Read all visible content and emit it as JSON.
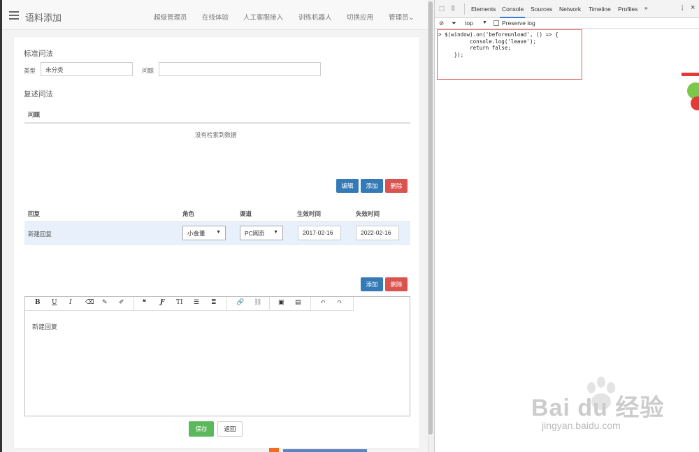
{
  "app": {
    "title": "语料添加",
    "nav": [
      "超级管理员",
      "在线体验",
      "人工客服接入",
      "训练机器人",
      "切换应用",
      "管理员"
    ]
  },
  "standard": {
    "heading": "标准问法",
    "type_label": "类型",
    "type_value": "未分类",
    "question_label": "问题",
    "question_value": ""
  },
  "paraphrase": {
    "heading": "复述问法",
    "col": "问题",
    "empty": "没有检索到数据",
    "btn_edit": "编辑",
    "btn_add": "添加",
    "btn_delete": "删除"
  },
  "reply": {
    "headers": [
      "回复",
      "角色",
      "渠道",
      "生效时间",
      "失效时间"
    ],
    "row": {
      "reply": "新建回复",
      "role": "小金董",
      "channel": "PC网页",
      "start": "2017-02-16",
      "end": "2022-02-16"
    },
    "btn_add": "添加",
    "btn_delete": "删除"
  },
  "editor": {
    "toolbar": [
      "B",
      "U",
      "I",
      "eraser-icon",
      "pen-icon",
      "brush-icon",
      "quote-icon",
      "clear-format-icon",
      "text-size-icon",
      "ul-icon",
      "ol-icon",
      "link-icon",
      "unlink-icon",
      "video-icon",
      "image-icon",
      "undo-icon",
      "redo-icon"
    ],
    "content": "新建回复"
  },
  "actions": {
    "save": "保存",
    "back": "返回"
  },
  "devtools": {
    "tabs": [
      "Elements",
      "Console",
      "Sources",
      "Network",
      "Timeline",
      "Profiles",
      "»"
    ],
    "context": "top",
    "preserve_log": "Preserve log",
    "code": "> $(window).on('beforeunload', () => {\n          console.log('leave');\n          return false;\n     });"
  },
  "watermark": {
    "brand": "Bai du 经验",
    "url": "jingyan.baidu.com"
  },
  "colors": {
    "primary": "#337ab7",
    "danger": "#d9534f",
    "success": "#5cb85c",
    "row_highlight": "#e8f1fb"
  }
}
